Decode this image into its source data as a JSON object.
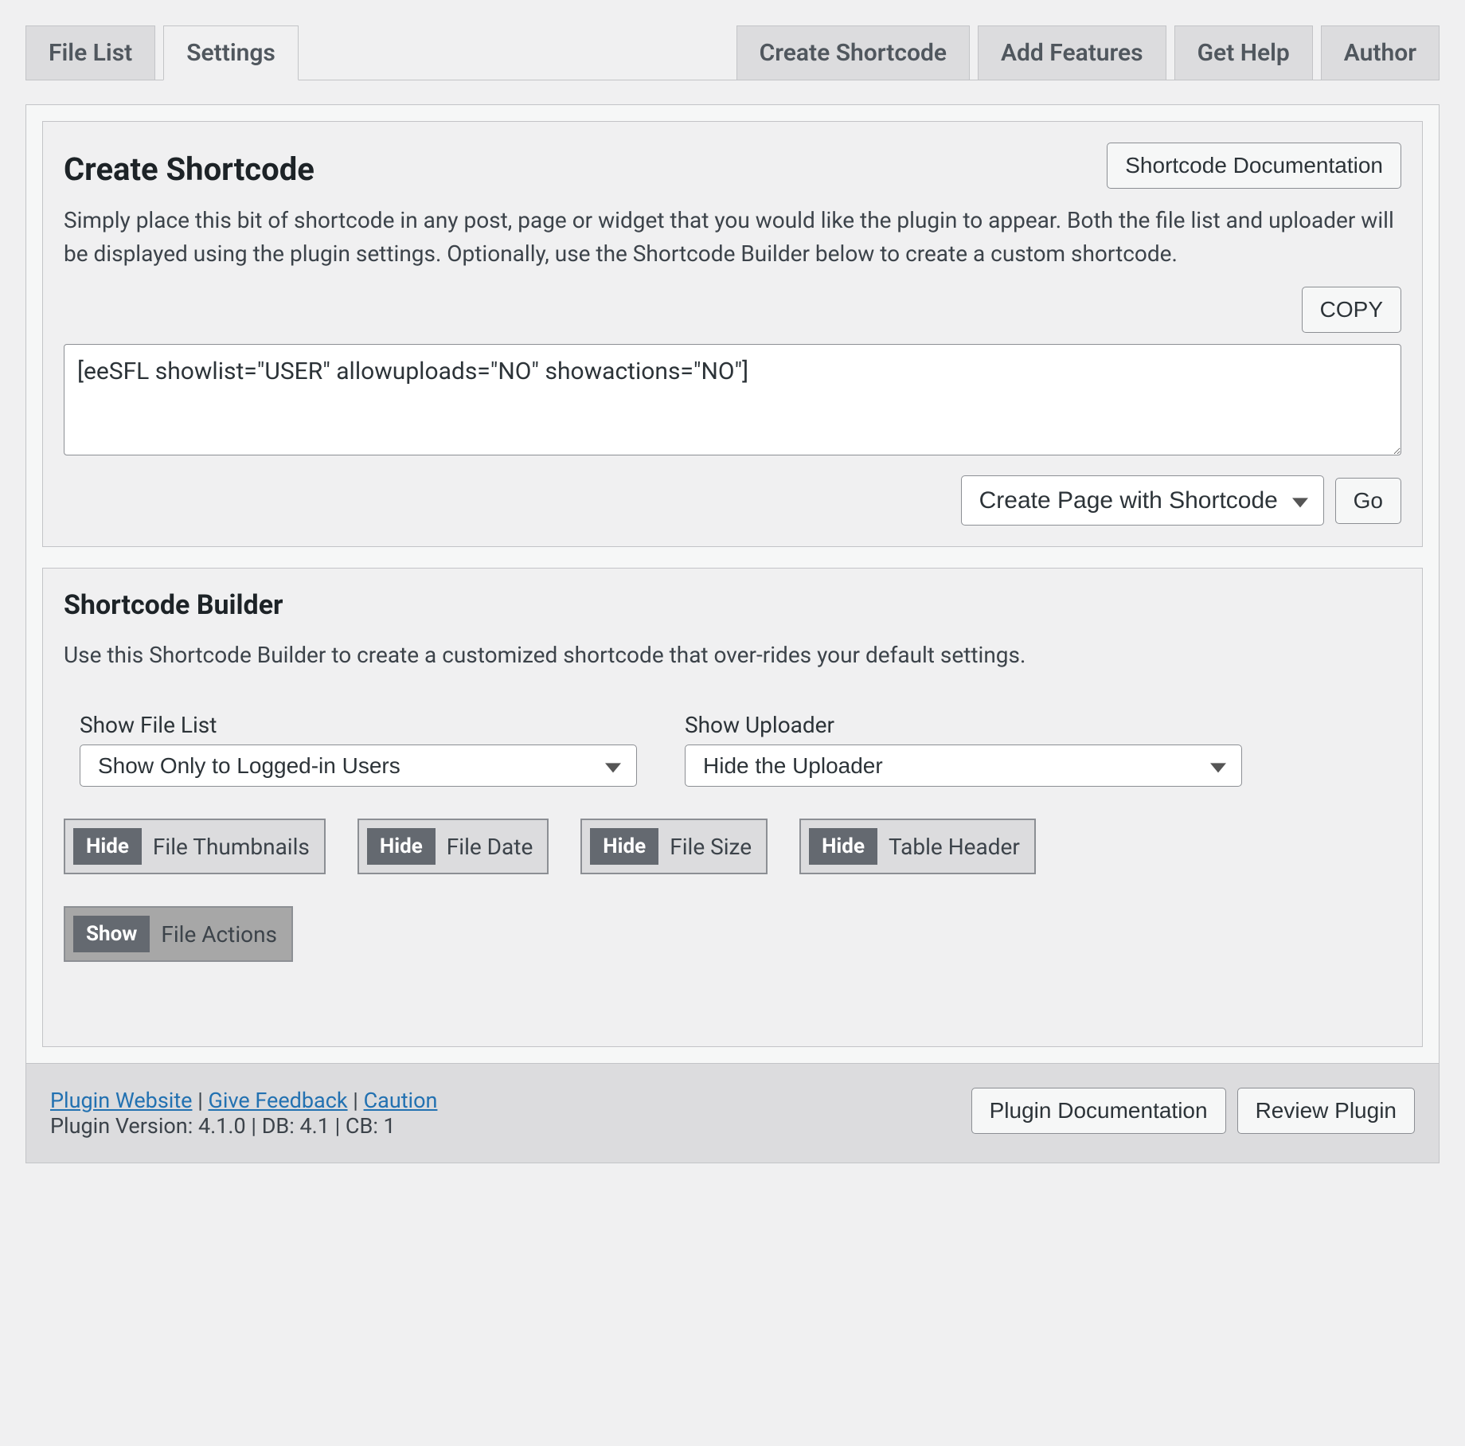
{
  "tabs": {
    "left": [
      {
        "label": "File List",
        "name": "tab-file-list",
        "active": false
      },
      {
        "label": "Settings",
        "name": "tab-settings",
        "active": true
      }
    ],
    "right": [
      {
        "label": "Create Shortcode",
        "name": "tab-create-shortcode"
      },
      {
        "label": "Add Features",
        "name": "tab-add-features"
      },
      {
        "label": "Get Help",
        "name": "tab-get-help"
      },
      {
        "label": "Author",
        "name": "tab-author"
      }
    ]
  },
  "create": {
    "heading": "Create Shortcode",
    "doc_button": "Shortcode Documentation",
    "description": "Simply place this bit of shortcode in any post, page or widget that you would like the plugin to appear. Both the file list and uploader will be displayed using the plugin settings. Optionally, use the Shortcode Builder below to create a custom shortcode.",
    "copy_button": "COPY",
    "shortcode_value": "[eeSFL showlist=\"USER\" allowuploads=\"NO\" showactions=\"NO\"]",
    "page_select": "Create Page with Shortcode",
    "go_button": "Go"
  },
  "builder": {
    "heading": "Shortcode Builder",
    "description": "Use this Shortcode Builder to create a customized shortcode that over-rides your default settings.",
    "show_file_list_label": "Show File List",
    "show_file_list_value": "Show Only to Logged-in Users",
    "show_uploader_label": "Show Uploader",
    "show_uploader_value": "Hide the Uploader",
    "toggles": [
      {
        "pill": "Hide",
        "label": "File Thumbnails",
        "active": false,
        "name": "toggle-file-thumbnails"
      },
      {
        "pill": "Hide",
        "label": "File Date",
        "active": false,
        "name": "toggle-file-date"
      },
      {
        "pill": "Hide",
        "label": "File Size",
        "active": false,
        "name": "toggle-file-size"
      },
      {
        "pill": "Hide",
        "label": "Table Header",
        "active": false,
        "name": "toggle-table-header"
      },
      {
        "pill": "Show",
        "label": "File Actions",
        "active": true,
        "name": "toggle-file-actions"
      }
    ]
  },
  "footer": {
    "links": [
      {
        "label": "Plugin Website",
        "name": "link-plugin-website"
      },
      {
        "label": "Give Feedback",
        "name": "link-give-feedback"
      },
      {
        "label": "Caution",
        "name": "link-caution"
      }
    ],
    "version_line": "Plugin Version: 4.1.0 | DB: 4.1 | CB: 1",
    "buttons": [
      {
        "label": "Plugin Documentation",
        "name": "btn-plugin-documentation"
      },
      {
        "label": "Review Plugin",
        "name": "btn-review-plugin"
      }
    ]
  }
}
